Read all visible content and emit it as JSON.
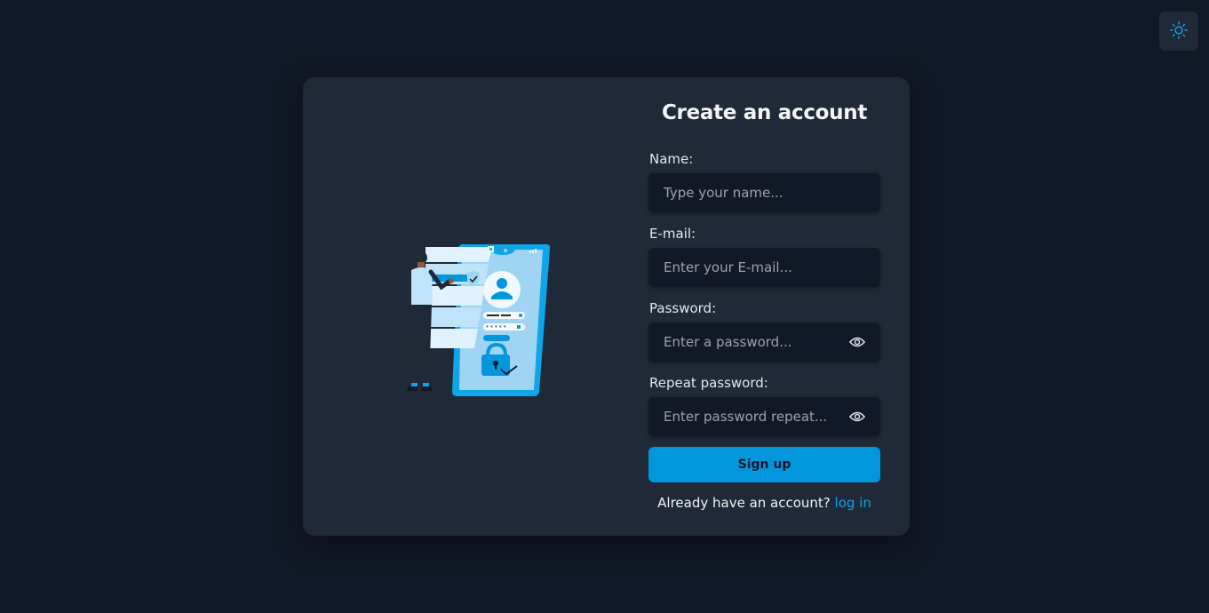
{
  "theme_toggle": {
    "icon": "sun-icon",
    "color": "#0ea5e9"
  },
  "form": {
    "title": "Create an account",
    "name": {
      "label": "Name:",
      "placeholder": "Type your name..."
    },
    "email": {
      "label": "E-mail:",
      "placeholder": "Enter your E-mail..."
    },
    "password": {
      "label": "Password:",
      "placeholder": "Enter a password...",
      "icon": "eye-icon"
    },
    "repeat_password": {
      "label": "Repeat password:",
      "placeholder": "Enter password repeat...",
      "icon": "eye-icon"
    },
    "submit_label": "Sign up",
    "footer_text": "Already have an account?",
    "login_link": "log in"
  },
  "colors": {
    "background": "#111827",
    "card": "#1f2937",
    "input": "#111827",
    "accent": "#0296dd",
    "link": "#0ea5e9"
  }
}
